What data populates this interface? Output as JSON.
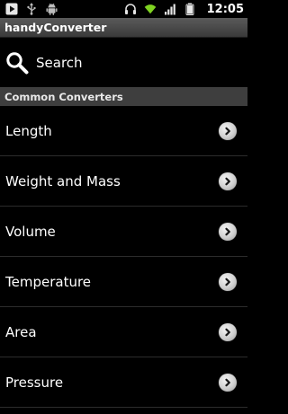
{
  "statusbar": {
    "left_icons": [
      "play-icon",
      "usb-icon",
      "android-icon"
    ],
    "right_icons": [
      "headphones-icon",
      "wifi-icon",
      "signal-icon",
      "battery-icon"
    ],
    "time": "12:05"
  },
  "titlebar": {
    "title": "handyConverter"
  },
  "search": {
    "label": "Search",
    "icon": "search-icon"
  },
  "section": {
    "header": "Common Converters"
  },
  "converters": [
    {
      "label": "Length",
      "icon": "chevron-right-icon"
    },
    {
      "label": "Weight and Mass",
      "icon": "chevron-right-icon"
    },
    {
      "label": "Volume",
      "icon": "chevron-right-icon"
    },
    {
      "label": "Temperature",
      "icon": "chevron-right-icon"
    },
    {
      "label": "Area",
      "icon": "chevron-right-icon"
    },
    {
      "label": "Pressure",
      "icon": "chevron-right-icon"
    }
  ],
  "colors": {
    "background": "#000000",
    "titlebar": "#4a4a4a",
    "section_header": "#3e3e3e",
    "wifi_accent": "#7fd321"
  }
}
